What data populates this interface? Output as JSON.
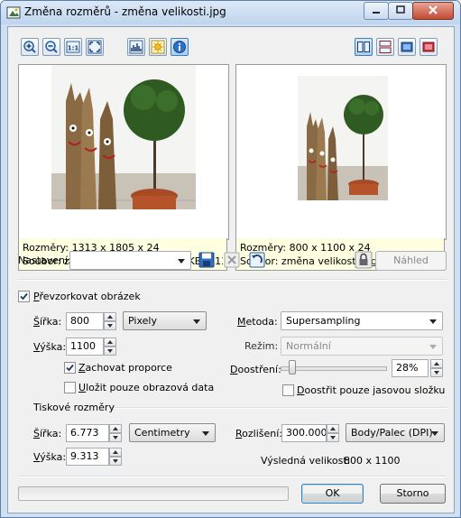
{
  "window": {
    "title": "Změna rozměrů - změna velikosti.jpg"
  },
  "toolbar": {
    "left_icons": [
      "zoom-in-icon",
      "zoom-out-icon",
      "actual-size-icon",
      "fit-window-icon",
      "histogram-icon",
      "sun-icon",
      "info-icon"
    ],
    "right_icons": [
      "split-vertical-icon",
      "split-horizontal-icon",
      "blue-square-icon",
      "red-square-icon"
    ]
  },
  "original": {
    "size_line": "Rozměry: 1313 x 1805 x 24",
    "file_line": "Soubor: změna velikosti.jpg, 208 KB (213 409 ..."
  },
  "result": {
    "size_line": "Rozměry: 800 x 1100 x 24",
    "file_line": "Soubor: změna velikosti.jpg"
  },
  "settings": {
    "label": "Nastavení:",
    "value": "",
    "preview_button": "Náhled"
  },
  "resample": {
    "checkbox_label": "Převzorkovat obrázek",
    "checked": true,
    "width_label": "Šířka:",
    "width_value": "800",
    "height_label": "Výška:",
    "height_value": "1100",
    "unit": "Pixely",
    "keep_ratio_label": "Zachovat proporce",
    "keep_ratio_checked": true,
    "save_only_label": "Uložit pouze obrazová data",
    "save_only_checked": false,
    "method_label": "Metoda:",
    "method_value": "Supersampling",
    "mode_label": "Režim:",
    "mode_value": "Normální",
    "sharpen_label": "Doostření:",
    "sharpen_value": "28%",
    "sharpen_level": 0.08,
    "sharpen_luma_label": "Doostřit pouze jasovou složku",
    "sharpen_luma_checked": false
  },
  "print": {
    "section_label": "Tiskové rozměry",
    "width_label": "Šířka:",
    "width_value": "6.773",
    "height_label": "Výška:",
    "height_value": "9.313",
    "unit": "Centimetry",
    "resolution_label": "Rozlišení:",
    "resolution_value": "300.000",
    "resolution_unit": "Body/Palec (DPI)",
    "result_label": "Výsledná velikost:",
    "result_value": "800 x 1100"
  },
  "buttons": {
    "ok": "OK",
    "cancel": "Storno"
  },
  "progress": 0
}
